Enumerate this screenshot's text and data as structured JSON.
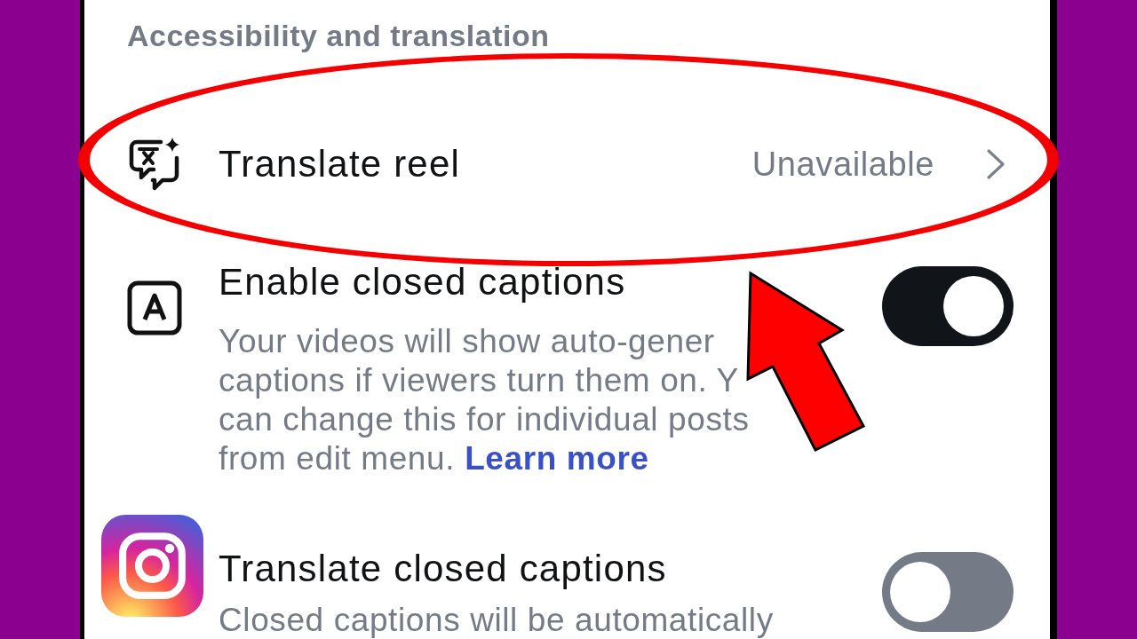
{
  "section_title": "Accessibility and translation",
  "rows": [
    {
      "kind": "link",
      "label": "Translate reel",
      "value": "Unavailable"
    },
    {
      "kind": "toggle",
      "label": "Enable closed captions",
      "on": true,
      "description_lines": [
        "Your videos will show auto-gener",
        "captions if viewers turn them on. Y",
        "can change this for individual posts",
        "from edit menu."
      ],
      "link": "Learn more"
    },
    {
      "kind": "toggle",
      "label": "Translate closed captions",
      "on": false,
      "description_lines": [
        "Closed captions will be automatically"
      ]
    }
  ]
}
